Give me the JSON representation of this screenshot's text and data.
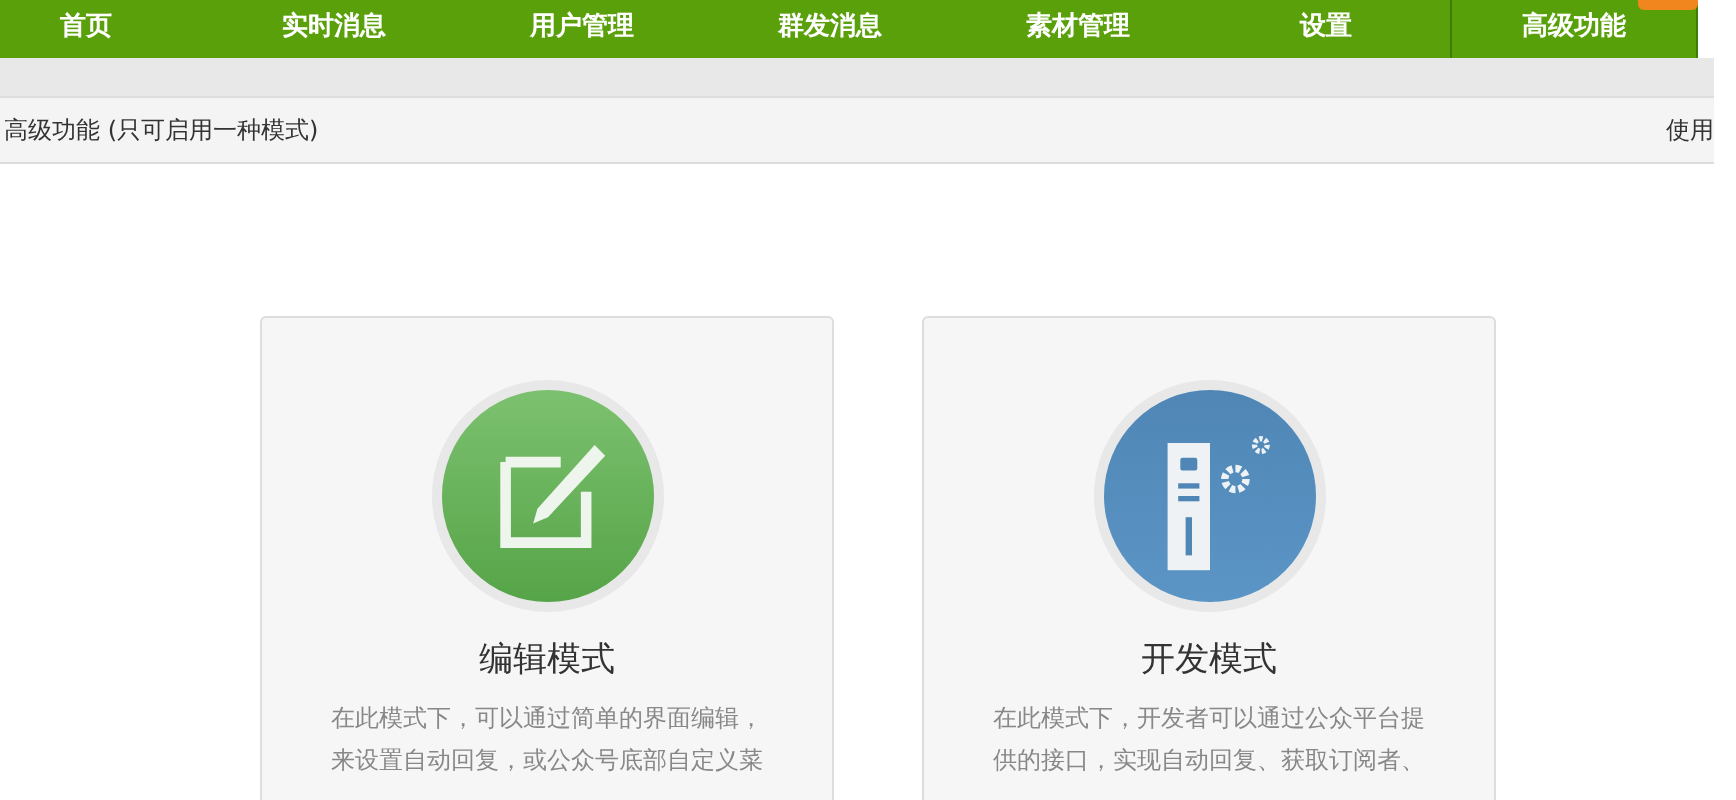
{
  "nav": {
    "items": [
      {
        "label": "首页",
        "selected": false
      },
      {
        "label": "实时消息",
        "selected": false
      },
      {
        "label": "用户管理",
        "selected": false
      },
      {
        "label": "群发消息",
        "selected": false
      },
      {
        "label": "素材管理",
        "selected": false
      },
      {
        "label": "设置",
        "selected": false
      },
      {
        "label": "高级功能",
        "selected": true,
        "badge": true
      }
    ]
  },
  "header": {
    "title": "高级功能 (只可启用一种模式)",
    "link": "使用"
  },
  "modes": [
    {
      "kind": "edit",
      "title": "编辑模式",
      "lines": [
        "在此模式下，可以通过简单的界面编辑，",
        "来设置自动回复，或公众号底部自定义菜"
      ]
    },
    {
      "kind": "develop",
      "title": "开发模式",
      "lines": [
        "在此模式下，开发者可以通过公众平台提",
        "供的接口，实现自动回复、获取订阅者、"
      ]
    }
  ]
}
